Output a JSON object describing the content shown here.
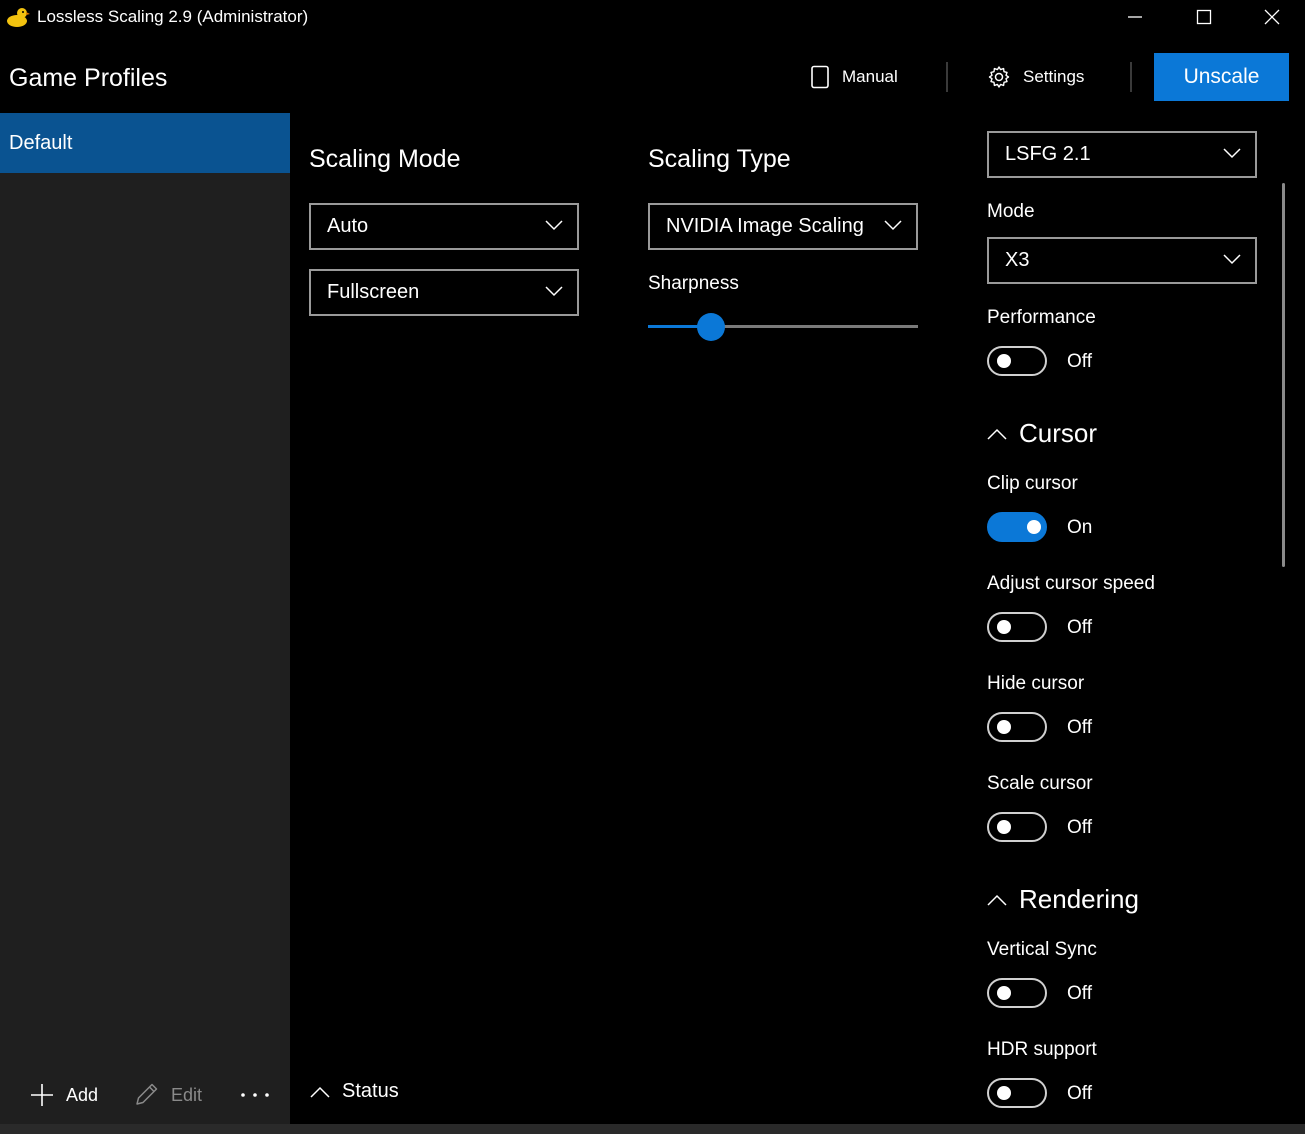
{
  "window": {
    "title": "Lossless Scaling 2.9 (Administrator)"
  },
  "header": {
    "title": "Game Profiles",
    "manual_label": "Manual",
    "settings_label": "Settings",
    "unscale_label": "Unscale"
  },
  "sidebar": {
    "profiles": [
      {
        "label": "Default",
        "selected": true
      }
    ],
    "add_label": "Add",
    "edit_label": "Edit",
    "more_label": "..."
  },
  "scaling_mode": {
    "title": "Scaling Mode",
    "mode_value": "Auto",
    "window_value": "Fullscreen"
  },
  "scaling_type": {
    "title": "Scaling Type",
    "type_value": "NVIDIA Image Scaling",
    "sharpness_label": "Sharpness",
    "sharpness_fraction": 0.23
  },
  "frame_gen": {
    "type_value": "LSFG 2.1",
    "mode_label": "Mode",
    "mode_value": "X3",
    "performance_label": "Performance",
    "performance_state": "Off"
  },
  "cursor": {
    "title": "Cursor",
    "clip_label": "Clip cursor",
    "clip_state": "On",
    "adjust_speed_label": "Adjust cursor speed",
    "adjust_speed_state": "Off",
    "hide_label": "Hide cursor",
    "hide_state": "Off",
    "scale_label": "Scale cursor",
    "scale_state": "Off"
  },
  "rendering": {
    "title": "Rendering",
    "vsync_label": "Vertical Sync",
    "vsync_state": "Off",
    "hdr_label": "HDR support",
    "hdr_state": "Off"
  },
  "status": {
    "label": "Status"
  },
  "colors": {
    "accent": "#0b78d7",
    "selected_profile": "#0a5391",
    "sidebar_bg": "#1f1f1f",
    "background": "#000000"
  }
}
